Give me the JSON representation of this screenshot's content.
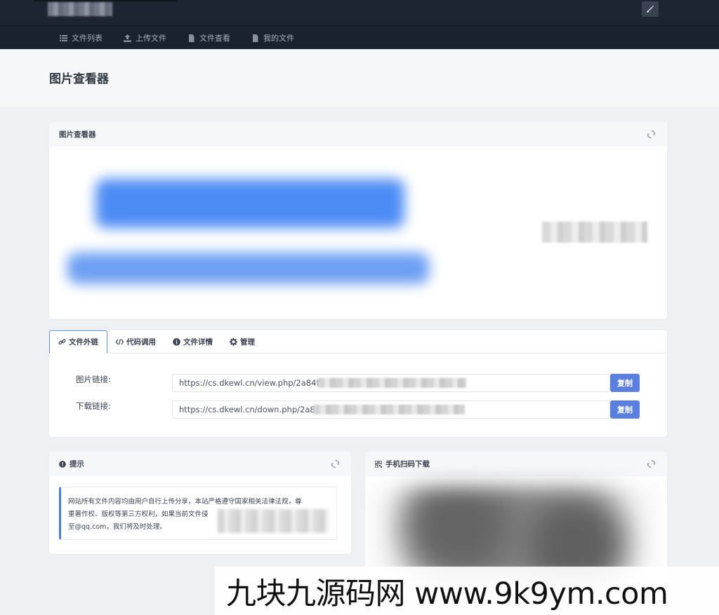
{
  "header": {
    "nav": [
      {
        "label": "文件列表",
        "icon": "list-icon"
      },
      {
        "label": "上传文件",
        "icon": "upload-icon"
      },
      {
        "label": "文件查看",
        "icon": "file-icon"
      },
      {
        "label": "我的文件",
        "icon": "file-icon"
      }
    ],
    "edit_icon": "brush-icon"
  },
  "page": {
    "title": "图片查看器"
  },
  "viewer": {
    "title": "图片查看器"
  },
  "tabs": [
    {
      "label": "文件外链",
      "icon": "link-icon",
      "active": true
    },
    {
      "label": "代码调用",
      "icon": "code-icon",
      "active": false
    },
    {
      "label": "文件详情",
      "icon": "info-icon",
      "active": false
    },
    {
      "label": "管理",
      "icon": "gear-icon",
      "active": false
    }
  ],
  "links": {
    "image_label": "图片链接:",
    "image_url": "https://cs.dkewl.cn/view.php/2a84f",
    "download_label": "下载链接:",
    "download_url": "https://cs.dkewl.cn/down.php/2a84",
    "copy_label": "复制"
  },
  "tips": {
    "title": "提示",
    "line1": "网站所有文件内容均由用户自行上传分享，本站严格遵守国家相关法律法规，尊",
    "line2": "重著作权、版权等第三方权利，如果当前文件侵",
    "line3": "至@qq.com，我们将及时处理。"
  },
  "qr": {
    "title": "手机扫码下载"
  },
  "watermark": "九块九源码网 www.9k9ym.com",
  "colors": {
    "accent": "#5a7fe0",
    "header_bg": "#1d2533"
  }
}
